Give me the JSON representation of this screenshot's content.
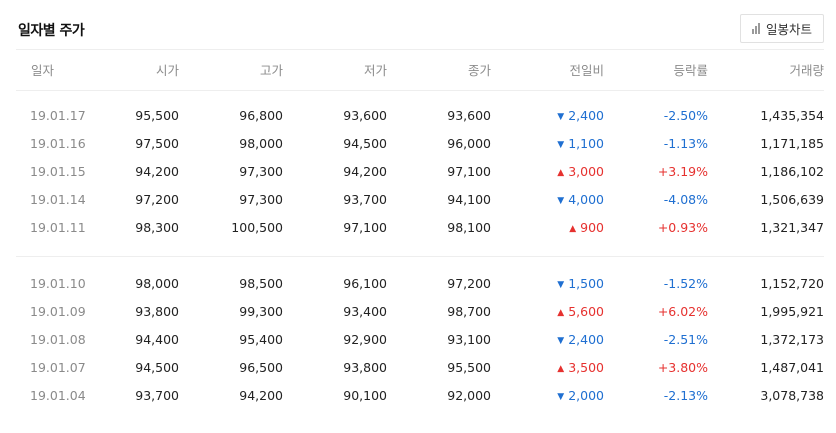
{
  "header": {
    "title": "일자별 주가",
    "chart_button_label": "일봉차트"
  },
  "columns": [
    "일자",
    "시가",
    "고가",
    "저가",
    "종가",
    "전일비",
    "등락률",
    "거래량"
  ],
  "groups": [
    [
      {
        "date": "19.01.17",
        "open": "95,500",
        "high": "96,800",
        "low": "93,600",
        "close": "93,600",
        "change": "2,400",
        "direction": "down",
        "rate": "-2.50%",
        "volume": "1,435,354"
      },
      {
        "date": "19.01.16",
        "open": "97,500",
        "high": "98,000",
        "low": "94,500",
        "close": "96,000",
        "change": "1,100",
        "direction": "down",
        "rate": "-1.13%",
        "volume": "1,171,185"
      },
      {
        "date": "19.01.15",
        "open": "94,200",
        "high": "97,300",
        "low": "94,200",
        "close": "97,100",
        "change": "3,000",
        "direction": "up",
        "rate": "+3.19%",
        "volume": "1,186,102"
      },
      {
        "date": "19.01.14",
        "open": "97,200",
        "high": "97,300",
        "low": "93,700",
        "close": "94,100",
        "change": "4,000",
        "direction": "down",
        "rate": "-4.08%",
        "volume": "1,506,639"
      },
      {
        "date": "19.01.11",
        "open": "98,300",
        "high": "100,500",
        "low": "97,100",
        "close": "98,100",
        "change": "900",
        "direction": "up",
        "rate": "+0.93%",
        "volume": "1,321,347"
      }
    ],
    [
      {
        "date": "19.01.10",
        "open": "98,000",
        "high": "98,500",
        "low": "96,100",
        "close": "97,200",
        "change": "1,500",
        "direction": "down",
        "rate": "-1.52%",
        "volume": "1,152,720"
      },
      {
        "date": "19.01.09",
        "open": "93,800",
        "high": "99,300",
        "low": "93,400",
        "close": "98,700",
        "change": "5,600",
        "direction": "up",
        "rate": "+6.02%",
        "volume": "1,995,921"
      },
      {
        "date": "19.01.08",
        "open": "94,400",
        "high": "95,400",
        "low": "92,900",
        "close": "93,100",
        "change": "2,400",
        "direction": "down",
        "rate": "-2.51%",
        "volume": "1,372,173"
      },
      {
        "date": "19.01.07",
        "open": "94,500",
        "high": "96,500",
        "low": "93,800",
        "close": "95,500",
        "change": "3,500",
        "direction": "up",
        "rate": "+3.80%",
        "volume": "1,487,041"
      },
      {
        "date": "19.01.04",
        "open": "93,700",
        "high": "94,200",
        "low": "90,100",
        "close": "92,000",
        "change": "2,000",
        "direction": "down",
        "rate": "-2.13%",
        "volume": "3,078,738"
      }
    ]
  ],
  "colors": {
    "up": "#e6312f",
    "down": "#1f6fd1"
  },
  "icons": {
    "chart_button": "bar-chart-icon",
    "up": "triangle-up-icon",
    "down": "triangle-down-icon"
  }
}
